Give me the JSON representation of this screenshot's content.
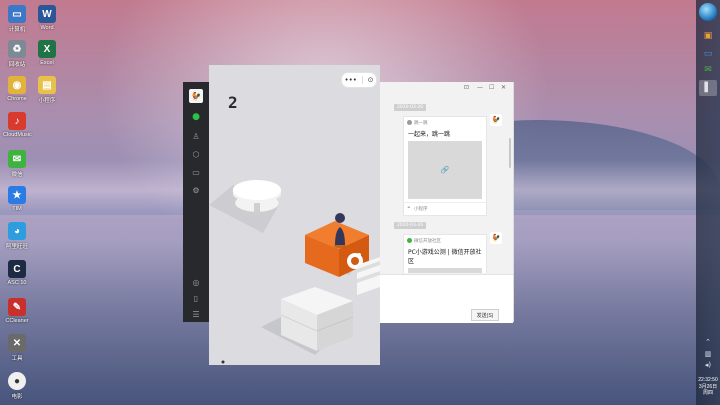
{
  "desktop": {
    "icons": [
      {
        "label": "计算机",
        "glyph": "▭",
        "color": "#3c78c8"
      },
      {
        "label": "Word",
        "glyph": "W",
        "color": "#2b579a"
      },
      {
        "label": "回收站",
        "glyph": "♻",
        "color": "#7d8a96"
      },
      {
        "label": "Excel",
        "glyph": "X",
        "color": "#217346"
      },
      {
        "label": "Chrome",
        "glyph": "◉",
        "color": "#e2b33b"
      },
      {
        "label": "小程序",
        "glyph": "▤",
        "color": "#e8c04a"
      },
      {
        "label": "CloudMusic",
        "glyph": "♪",
        "color": "#d83a2e"
      },
      {
        "label": "微信",
        "glyph": "✉",
        "color": "#3fb23f"
      },
      {
        "label": "TIM",
        "glyph": "★",
        "color": "#2a7be4"
      },
      {
        "label": "阿里旺旺",
        "glyph": "◕",
        "color": "#2e9de0"
      },
      {
        "label": "ASC 10",
        "glyph": "C",
        "color": "#1c2a44"
      },
      {
        "label": "CCleaner",
        "glyph": "✎",
        "color": "#c9302c"
      },
      {
        "label": "工具",
        "glyph": "✕",
        "color": "#6a6a6a"
      },
      {
        "label": "电影",
        "glyph": "●",
        "color": "#f0f0f0"
      }
    ]
  },
  "taskbar": {
    "items": [
      {
        "name": "browser",
        "glyph": "▣",
        "color": "#e9a23b"
      },
      {
        "name": "computer",
        "glyph": "▭",
        "color": "#4a90d9"
      },
      {
        "name": "wechat",
        "glyph": "✉",
        "color": "#4ab34a"
      },
      {
        "name": "devtools",
        "glyph": "▌",
        "color": "#dfe3ea"
      }
    ],
    "clock": {
      "time": "22:32:50",
      "date": "3月26日",
      "weekday": "周四"
    }
  },
  "game": {
    "score": "2",
    "capsule_more": "•••",
    "capsule_close": "⊙"
  },
  "chat": {
    "window_controls": {
      "pin": "⊡",
      "min": "—",
      "max": "☐",
      "close": "✕"
    },
    "messages": [
      {
        "time": "2020-03-26",
        "source": "跳一跳",
        "title": "一起来，跳一跳",
        "footer": "小程序",
        "link_icon": "🔗"
      },
      {
        "time": "2020-03-26",
        "source": "微信开放社区",
        "title": "PC小游戏公测 | 微信开放社区",
        "footer": ""
      }
    ],
    "send_label": "发送(S)"
  }
}
